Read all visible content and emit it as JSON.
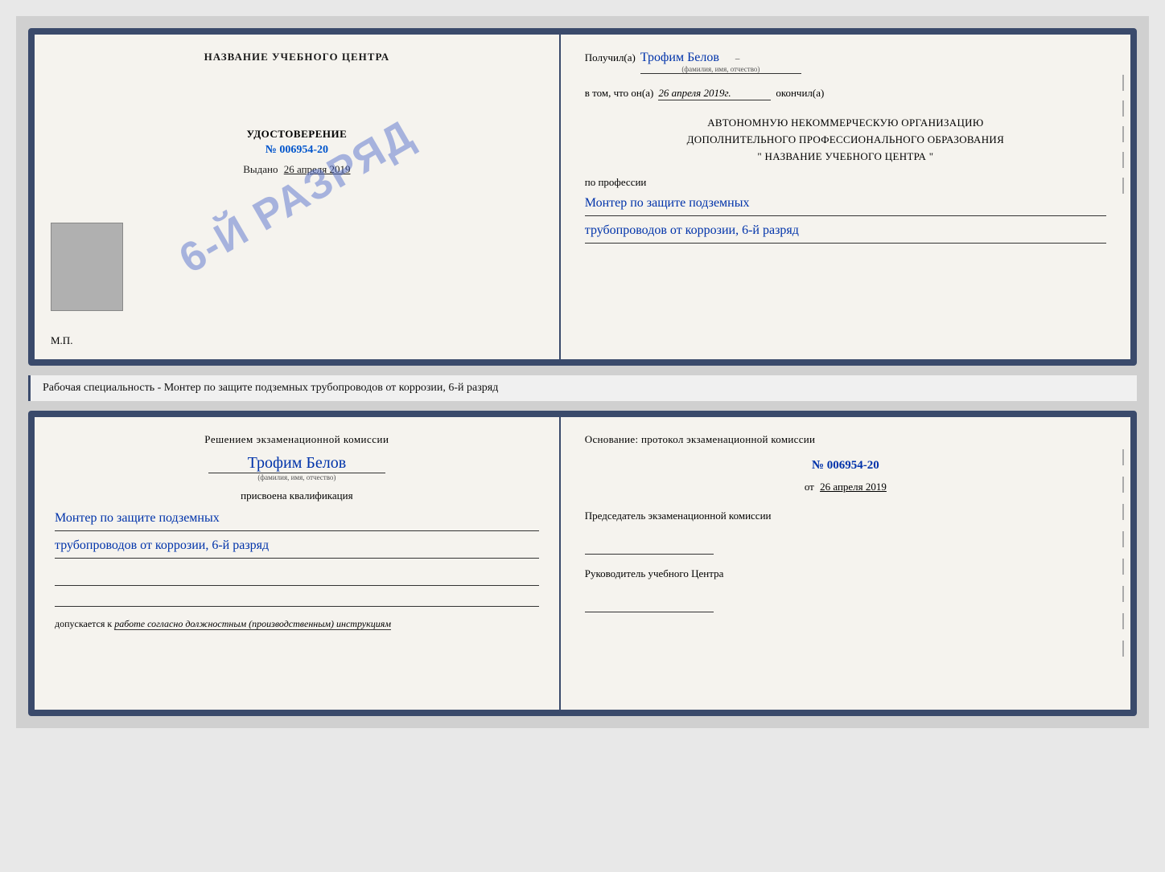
{
  "page": {
    "background_color": "#d0d0d0"
  },
  "top_cert": {
    "left": {
      "title": "НАЗВАНИЕ УЧЕБНОГО ЦЕНТРА",
      "stamp_text": "6-й разряд",
      "udostoverenie_label": "УДОСТОВЕРЕНИЕ",
      "number": "№ 006954-20",
      "vydano_label": "Выдано",
      "vydano_date": "26 апреля 2019",
      "mp_label": "М.П."
    },
    "right": {
      "poluchil_label": "Получил(а)",
      "poluchil_name": "Трофим Белов",
      "fio_hint": "(фамилия, имя, отчество)",
      "vtom_prefix": "в том, что он(а)",
      "date_value": "26 апреля 2019г.",
      "okonchil_label": "окончил(а)",
      "org_line1": "АВТОНОМНУЮ НЕКОММЕРЧЕСКУЮ ОРГАНИЗАЦИЮ",
      "org_line2": "ДОПОЛНИТЕЛЬНОГО ПРОФЕССИОНАЛЬНОГО ОБРАЗОВАНИЯ",
      "org_quote_open": "\"",
      "org_name": "НАЗВАНИЕ УЧЕБНОГО ЦЕНТРА",
      "org_quote_close": "\"",
      "po_professii_label": "по профессии",
      "profession_line1": "Монтер по защите подземных",
      "profession_line2": "трубопроводов от коррозии, 6-й разряд"
    }
  },
  "specialty_banner": {
    "text": "Рабочая специальность - Монтер по защите подземных трубопроводов от коррозии, 6-й разряд"
  },
  "bottom_cert": {
    "left": {
      "resheniem_title": "Решением экзаменационной комиссии",
      "fio": "Трофим Белов",
      "fio_hint": "(фамилия, имя, отчество)",
      "prisvoena_label": "присвоена квалификация",
      "kvalifikaciya_line1": "Монтер по защите подземных",
      "kvalifikaciya_line2": "трубопроводов от коррозии, 6-й разряд",
      "dopuskaetsya_label": "допускается к",
      "dopuskaetsya_value": "работе согласно должностным (производственным) инструкциям"
    },
    "right": {
      "osnovanie_text": "Основание: протокол экзаменационной комиссии",
      "number": "№  006954-20",
      "ot_label": "от",
      "ot_date": "26 апреля 2019",
      "predsedatel_label": "Председатель экзаменационной комиссии",
      "rukovoditel_label": "Руководитель учебного Центра"
    }
  }
}
